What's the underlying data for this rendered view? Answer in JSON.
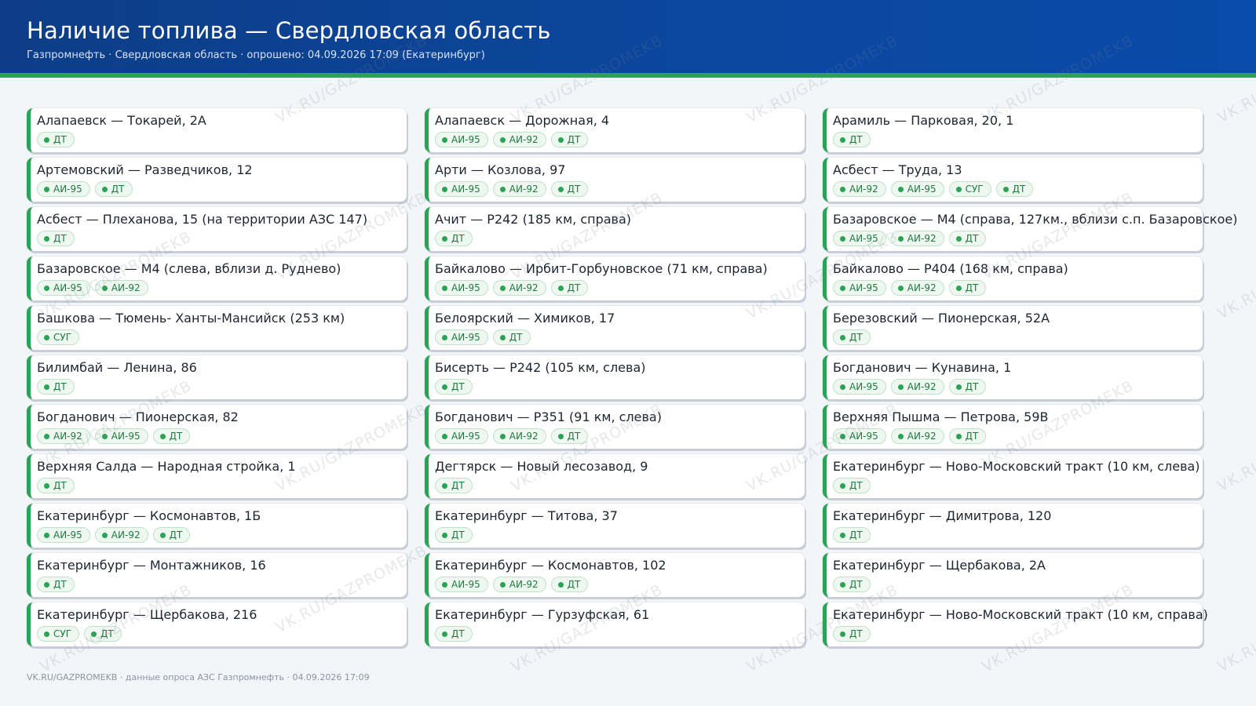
{
  "header": {
    "title": "Наличие топлива — Свердловская область",
    "subtitle": "Газпромнефть · Свердловская область · опрошено: 04.09.2026 17:09 (Екатеринбург)"
  },
  "stations": [
    {
      "name": "Алапаевск — Токарей, 2А",
      "fuels": [
        "ДТ"
      ]
    },
    {
      "name": "Алапаевск — Дорожная, 4",
      "fuels": [
        "АИ-95",
        "АИ-92",
        "ДТ"
      ]
    },
    {
      "name": "Арамиль — Парковая, 20, 1",
      "fuels": [
        "ДТ"
      ]
    },
    {
      "name": "Артемовский — Разведчиков, 12",
      "fuels": [
        "АИ-95",
        "ДТ"
      ]
    },
    {
      "name": "Арти — Козлова, 97",
      "fuels": [
        "АИ-95",
        "АИ-92",
        "ДТ"
      ]
    },
    {
      "name": "Асбест — Труда, 13",
      "fuels": [
        "АИ-92",
        "АИ-95",
        "СУГ",
        "ДТ"
      ]
    },
    {
      "name": "Асбест — Плеханова, 15 (на территории АЗС 147)",
      "fuels": [
        "ДТ"
      ]
    },
    {
      "name": "Ачит — Р242 (185 км, справа)",
      "fuels": [
        "ДТ"
      ]
    },
    {
      "name": "Базаровское — М4 (справа, 127км., вблизи с.п. Базаровское)",
      "fuels": [
        "АИ-95",
        "АИ-92",
        "ДТ"
      ]
    },
    {
      "name": "Базаровское — М4 (слева, вблизи д. Руднево)",
      "fuels": [
        "АИ-95",
        "АИ-92"
      ]
    },
    {
      "name": "Байкалово — Ирбит-Горбуновское (71 км, справа)",
      "fuels": [
        "АИ-95",
        "АИ-92",
        "ДТ"
      ]
    },
    {
      "name": "Байкалово — Р404 (168 км, справа)",
      "fuels": [
        "АИ-95",
        "АИ-92",
        "ДТ"
      ]
    },
    {
      "name": "Башкова — Тюмень- Ханты-Мансийск (253 км)",
      "fuels": [
        "СУГ"
      ]
    },
    {
      "name": "Белоярский — Химиков, 17",
      "fuels": [
        "АИ-95",
        "ДТ"
      ]
    },
    {
      "name": "Березовский — Пионерская, 52А",
      "fuels": [
        "ДТ"
      ]
    },
    {
      "name": "Билимбай — Ленина, 86",
      "fuels": [
        "ДТ"
      ]
    },
    {
      "name": "Бисерть — Р242 (105 км, слева)",
      "fuels": [
        "ДТ"
      ]
    },
    {
      "name": "Богданович — Кунавина, 1",
      "fuels": [
        "АИ-95",
        "АИ-92",
        "ДТ"
      ]
    },
    {
      "name": "Богданович — Пионерская, 82",
      "fuels": [
        "АИ-92",
        "АИ-95",
        "ДТ"
      ]
    },
    {
      "name": "Богданович — Р351 (91 км, слева)",
      "fuels": [
        "АИ-95",
        "АИ-92",
        "ДТ"
      ]
    },
    {
      "name": "Верхняя Пышма — Петрова, 59В",
      "fuels": [
        "АИ-95",
        "АИ-92",
        "ДТ"
      ]
    },
    {
      "name": "Верхняя Салда — Народная стройка, 1",
      "fuels": [
        "ДТ"
      ]
    },
    {
      "name": "Дегтярск — Новый лесозавод, 9",
      "fuels": [
        "ДТ"
      ]
    },
    {
      "name": "Екатеринбург — Ново-Московский тракт (10 км, слева)",
      "fuels": [
        "ДТ"
      ]
    },
    {
      "name": "Екатеринбург — Космонавтов, 1Б",
      "fuels": [
        "АИ-95",
        "АИ-92",
        "ДТ"
      ]
    },
    {
      "name": "Екатеринбург — Титова, 37",
      "fuels": [
        "ДТ"
      ]
    },
    {
      "name": "Екатеринбург — Димитрова, 120",
      "fuels": [
        "ДТ"
      ]
    },
    {
      "name": "Екатеринбург — Монтажников, 16",
      "fuels": [
        "ДТ"
      ]
    },
    {
      "name": "Екатеринбург — Космонавтов, 102",
      "fuels": [
        "АИ-95",
        "АИ-92",
        "ДТ"
      ]
    },
    {
      "name": "Екатеринбург — Щербакова, 2А",
      "fuels": [
        "ДТ"
      ]
    },
    {
      "name": "Екатеринбург — Щербакова, 216",
      "fuels": [
        "СУГ",
        "ДТ"
      ]
    },
    {
      "name": "Екатеринбург — Гурзуфская, 61",
      "fuels": [
        "ДТ"
      ]
    },
    {
      "name": "Екатеринбург — Ново-Московский тракт (10 км, справа)",
      "fuels": [
        "ДТ"
      ]
    }
  ],
  "footer": {
    "text": "VK.RU/GAZPROMEKB · данные опроса АЗС Газпромнефть · 04.09.2026 17:09"
  },
  "watermark": "VK.RU/GAZPROMEKB",
  "colors": {
    "header": "#0b48a0",
    "accent": "#2aa354",
    "badge_text": "#1f7a40",
    "background": "#f3f6f9"
  }
}
